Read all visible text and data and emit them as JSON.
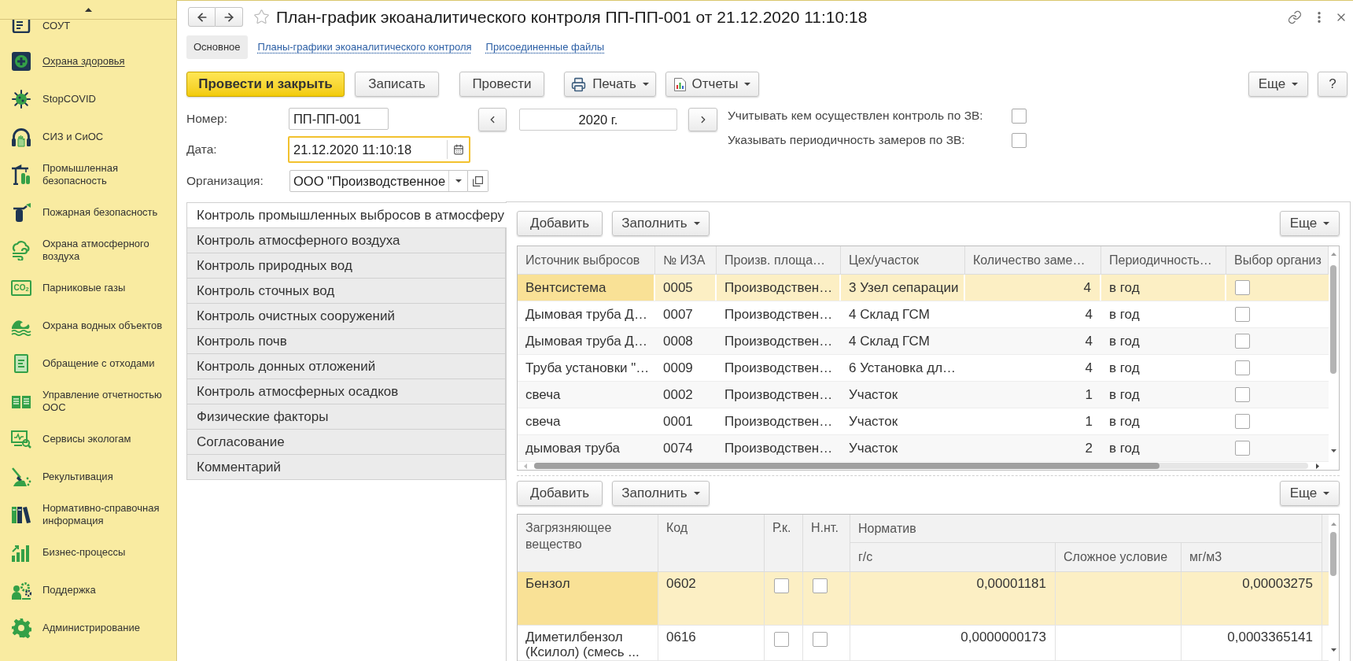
{
  "sidebar": {
    "items": [
      {
        "label": "СОУТ",
        "selected": false
      },
      {
        "label": "Охрана здоровья",
        "selected": true
      },
      {
        "label": "StopCOVID",
        "selected": false
      },
      {
        "label": "СИЗ и СиОС",
        "selected": false
      },
      {
        "label": "Промышленная безопасность",
        "selected": false
      },
      {
        "label": "Пожарная безопасность",
        "selected": false
      },
      {
        "label": "Охрана атмосферного воздуха",
        "selected": false
      },
      {
        "label": "Парниковые газы",
        "selected": false,
        "icon_text": "CO$_{2}$"
      },
      {
        "label": "Охрана водных объектов",
        "selected": false
      },
      {
        "label": "Обращение с отходами",
        "selected": false
      },
      {
        "label": "Управление отчетностью ООС",
        "selected": false
      },
      {
        "label": "Сервисы экологам",
        "selected": false
      },
      {
        "label": "Рекультивация",
        "selected": false
      },
      {
        "label": "Нормативно-справочная информация",
        "selected": false
      },
      {
        "label": "Бизнес-процессы",
        "selected": false
      },
      {
        "label": "Поддержка",
        "selected": false
      },
      {
        "label": "Администрирование",
        "selected": false
      }
    ]
  },
  "window": {
    "title": "План-график экоаналитического контроля ПП-ПП-001 от 21.12.2020 11:10:18",
    "favorite": false
  },
  "form_tabs": [
    {
      "label": "Основное",
      "selected": true
    },
    {
      "label": "Планы-графики экоаналитического контроля",
      "selected": false
    },
    {
      "label": "Присоединенные файлы",
      "selected": false
    }
  ],
  "command_bar": {
    "buttons": [
      {
        "label": "Провести и закрыть",
        "kind": "default"
      },
      {
        "label": "Записать",
        "kind": "plain"
      },
      {
        "label": "Провести",
        "kind": "plain"
      },
      {
        "label": "Печать",
        "kind": "print"
      },
      {
        "label": "Отчеты",
        "kind": "reports"
      }
    ],
    "more": "Еще",
    "help": "?"
  },
  "fields": {
    "number": {
      "label": "Номер:",
      "value": "ПП-ПП-001"
    },
    "date": {
      "label": "Дата:",
      "value": "21.12.2020 11:10:18",
      "focused": true
    },
    "organization": {
      "label": "Организация:",
      "value": "ООО \"Производственное"
    }
  },
  "period": {
    "value": "2020 г."
  },
  "options": [
    {
      "label": "Учитывать кем осуществлен контроль по ЗВ:",
      "checked": false
    },
    {
      "label": "Указывать периодичность замеров по ЗВ:",
      "checked": false
    }
  ],
  "sections": [
    {
      "label": "Контроль промышленных выбросов в атмосферу",
      "selected": true
    },
    {
      "label": "Контроль атмосферного воздуха",
      "selected": false
    },
    {
      "label": "Контроль природных вод",
      "selected": false
    },
    {
      "label": "Контроль сточных вод",
      "selected": false
    },
    {
      "label": "Контроль очистных сооружений",
      "selected": false
    },
    {
      "label": "Контроль почв",
      "selected": false
    },
    {
      "label": "Контроль донных отложений",
      "selected": false
    },
    {
      "label": "Контроль атмосферных осадков",
      "selected": false
    },
    {
      "label": "Физические факторы",
      "selected": false
    },
    {
      "label": "Согласование",
      "selected": false
    },
    {
      "label": "Комментарий",
      "selected": false
    }
  ],
  "sources_table": {
    "buttons": [
      {
        "label": "Добавить",
        "kind": "plain"
      },
      {
        "label": "Заполнить",
        "kind": "menu"
      }
    ],
    "more": "Еще",
    "columns": [
      "Источник выбросов",
      "№ ИЗА",
      "Произв. площа…",
      "Цех/участок",
      "Количество заме…",
      "Периодичность…",
      "Выбор организ"
    ],
    "rows": [
      {
        "cells": [
          "Вентсистема",
          "0005",
          "Производствен…",
          "3 Узел сепарации",
          "4",
          "в год"
        ],
        "checked": false,
        "selected": true
      },
      {
        "cells": [
          "Дымовая труба Д…",
          "0007",
          "Производствен…",
          "4 Склад ГСМ",
          "4",
          "в год"
        ],
        "checked": false,
        "selected": false
      },
      {
        "cells": [
          "Дымовая труба Д…",
          "0008",
          "Производствен…",
          "4 Склад ГСМ",
          "4",
          "в год"
        ],
        "checked": false,
        "selected": false
      },
      {
        "cells": [
          "Труба установки \"…",
          "0009",
          "Производствен…",
          "6 Установка дл…",
          "4",
          "в год"
        ],
        "checked": false,
        "selected": false
      },
      {
        "cells": [
          "свеча",
          "0002",
          "Производствен…",
          "Участок",
          "1",
          "в год"
        ],
        "checked": false,
        "selected": false
      },
      {
        "cells": [
          "свеча",
          "0001",
          "Производствен…",
          "Участок",
          "1",
          "в год"
        ],
        "checked": false,
        "selected": false
      },
      {
        "cells": [
          "дымовая труба",
          "0074",
          "Производствен…",
          "Участок",
          "2",
          "в год"
        ],
        "checked": false,
        "selected": false
      }
    ]
  },
  "substances_table": {
    "buttons": [
      {
        "label": "Добавить",
        "kind": "plain"
      },
      {
        "label": "Заполнить",
        "kind": "menu"
      }
    ],
    "more": "Еще",
    "columns": [
      "Загрязняющее вещество",
      "Код",
      "Р.к.",
      "Н.нт."
    ],
    "group": {
      "label": "Норматив",
      "columns": [
        "г/с",
        "Сложное условие",
        "мг/м3"
      ]
    },
    "rows": [
      {
        "substance": "Бензол",
        "code": "0602",
        "rk": false,
        "nnt": false,
        "gs": "0,00001181",
        "mgm3": "0,00003275",
        "selected": true
      },
      {
        "substance": "Диметилбензол (Ксилол) (смесь ...",
        "code": "0616",
        "rk": false,
        "nnt": false,
        "gs": "0,0000000173",
        "mgm3": "0,0003365141",
        "selected": false
      }
    ]
  }
}
